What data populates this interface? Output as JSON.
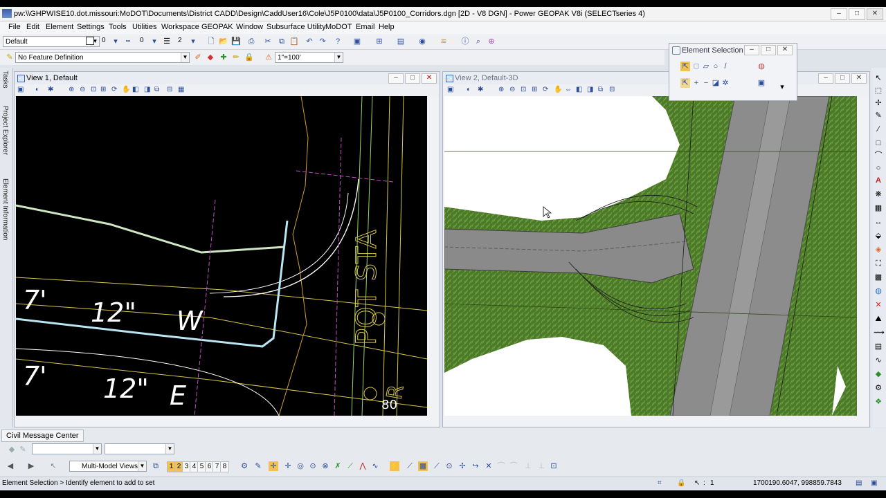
{
  "window": {
    "title": "pw:\\\\GHPWISE10.dot.missouri:MoDOT\\Documents\\District CADD\\Design\\CaddUser16\\Cole\\J5P0100\\data\\J5P0100_Corridors.dgn [2D - V8 DGN] - Power GEOPAK V8i (SELECTseries 4)",
    "minimize": "–",
    "maximize": "□",
    "close": "✕"
  },
  "menu": [
    "File",
    "Edit",
    "Element",
    "Settings",
    "Tools",
    "Utilities",
    "Workspace",
    "GEOPAK",
    "Window",
    "Subsurface Utility",
    "MoDOT",
    "Email",
    "Help"
  ],
  "toolbar": {
    "level_value": "Default",
    "color_value": "0",
    "style_value": "0",
    "weight_value": "2",
    "feature_definition": "No Feature Definition",
    "scale_value": "1\"=100'"
  },
  "side_tabs": [
    "Tasks",
    "Project Explorer",
    "Element Information"
  ],
  "view1": {
    "title": "View 1, Default",
    "cad_text": [
      "7'",
      "12\"",
      "W",
      "7'",
      "12\"",
      "E",
      "POT STA",
      "R",
      "80"
    ]
  },
  "view2": {
    "title": "View 2, Default-3D"
  },
  "element_selection": {
    "title": "Element Selection"
  },
  "message_center": {
    "label": "Civil Message Center"
  },
  "bottom_toolbar": {
    "views_label": "Multi-Model Views",
    "view_numbers": [
      "1",
      "2",
      "3",
      "4",
      "5",
      "6",
      "7",
      "8"
    ]
  },
  "status": {
    "prompt": "Element Selection > Identify element to add to set",
    "selection_count": "1",
    "coordinates": "1700190.6047, 998859.7843"
  },
  "colors": {
    "cad_background": "#000000",
    "terrain_green": "#4d7a2a",
    "road_gray": "#8c8c8c",
    "highlight_orange": "#f2c14e"
  }
}
